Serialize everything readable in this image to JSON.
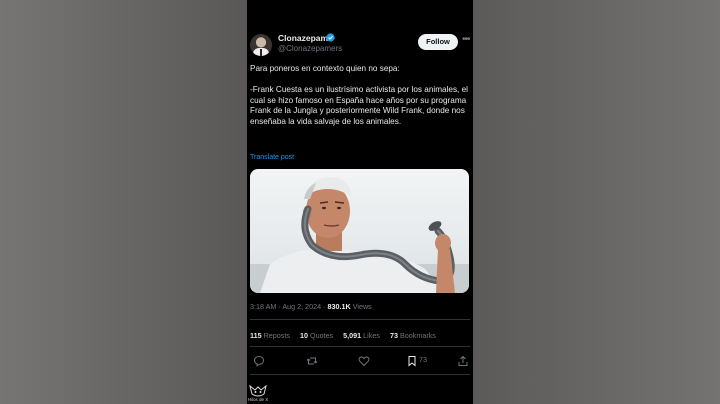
{
  "post": {
    "author_name": "Clonazepam",
    "author_handle": "@Clonazepamers",
    "follow_label": "Follow",
    "text_intro": "Para poneros en contexto quien no sepa:",
    "text_body": "-Frank Cuesta es un ilustrísimo activista por los animales, el cual se hizo famoso en España hace años por su programa Frank de la Jungla y posteriormente Wild Frank, donde nos enseñaba la vida salvaje de los animales.",
    "translate_label": "Translate post",
    "time": "3:18 AM",
    "date": "Aug 2, 2024",
    "views_count": "830.1K",
    "views_label": "Views",
    "reposts_count": "115",
    "reposts_label": "Reposts",
    "quotes_count": "10",
    "quotes_label": "Quotes",
    "likes_count": "5,091",
    "likes_label": "Likes",
    "bookmarks_count": "73",
    "bookmarks_label": "Bookmarks",
    "bookmark_action_count": "73"
  },
  "watermark": {
    "label": "Hilos de X"
  },
  "colors": {
    "accent": "#1d9bf0",
    "background": "#000000",
    "muted": "#71767b"
  }
}
